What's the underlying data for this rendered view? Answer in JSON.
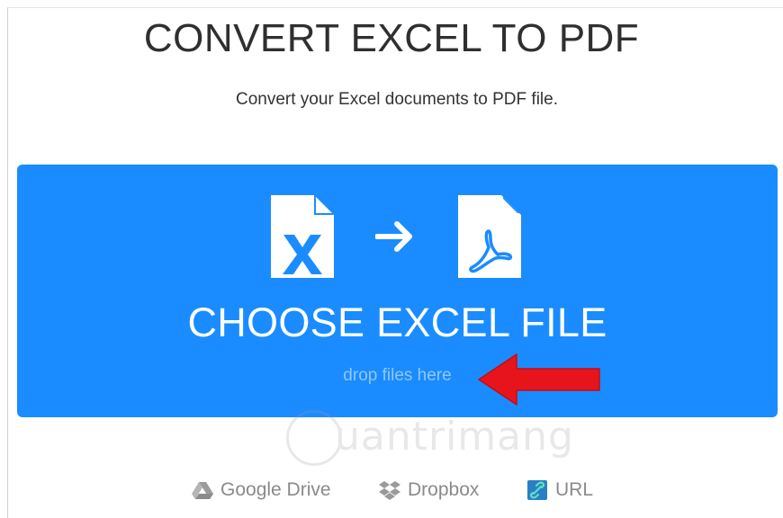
{
  "header": {
    "title": "CONVERT EXCEL TO PDF",
    "subtitle": "Convert your Excel documents to PDF file."
  },
  "upload": {
    "choose_label": "CHOOSE EXCEL FILE",
    "drop_hint": "drop files here",
    "from_icon": "excel-file-icon",
    "to_icon": "pdf-file-icon"
  },
  "watermark": {
    "text": "uantrimang"
  },
  "sources": [
    {
      "label": "Google Drive",
      "icon": "google-drive-icon"
    },
    {
      "label": "Dropbox",
      "icon": "dropbox-icon"
    },
    {
      "label": "URL",
      "icon": "link-icon"
    }
  ],
  "colors": {
    "accent": "#1a8cff",
    "title_text": "#2f2f2f",
    "annotation_arrow": "#e8141b"
  }
}
